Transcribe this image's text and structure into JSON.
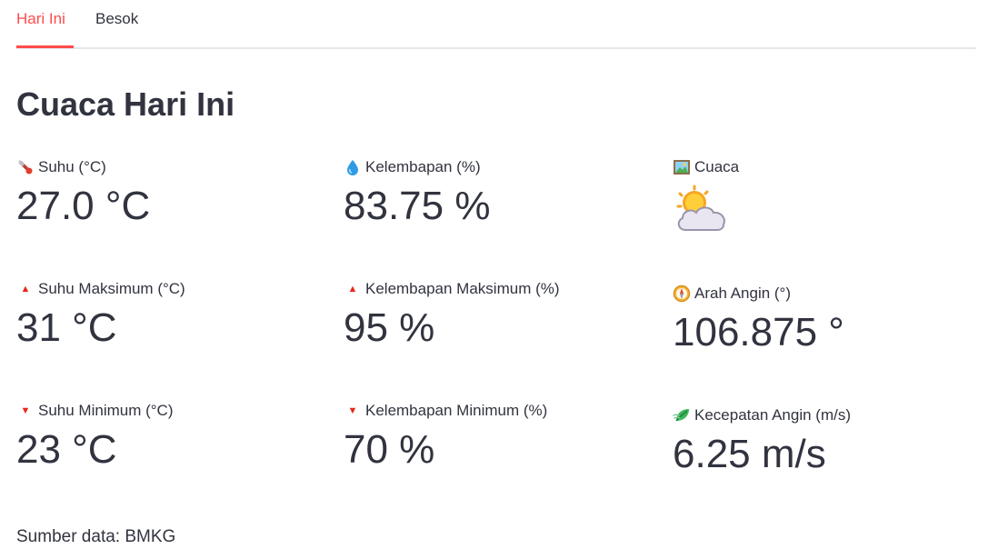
{
  "tabs": [
    {
      "label": "Hari Ini",
      "active": true
    },
    {
      "label": "Besok",
      "active": false
    }
  ],
  "title": "Cuaca Hari Ini",
  "metrics": {
    "suhu": {
      "label": "Suhu (°C)",
      "value": "27.0 °C",
      "icon": "thermometer-icon"
    },
    "kelembapan": {
      "label": "Kelembapan (%)",
      "value": "83.75 %",
      "icon": "droplet-icon"
    },
    "cuaca": {
      "label": "Cuaca",
      "icon": "picture-icon",
      "value_icon": "sun-behind-cloud-icon"
    },
    "suhu_max": {
      "label": "Suhu Maksimum (°C)",
      "value": "31 °C",
      "icon": "arrow-up-icon"
    },
    "kelembapan_max": {
      "label": "Kelembapan Maksimum (%)",
      "value": "95 %",
      "icon": "arrow-up-icon"
    },
    "arah_angin": {
      "label": "Arah Angin (°)",
      "value": "106.875 °",
      "icon": "compass-icon"
    },
    "suhu_min": {
      "label": "Suhu Minimum (°C)",
      "value": "23 °C",
      "icon": "arrow-down-icon"
    },
    "kelembapan_min": {
      "label": "Kelembapan Minimum (%)",
      "value": "70 %",
      "icon": "arrow-down-icon"
    },
    "kecepatan_angin": {
      "label": "Kecepatan Angin (m/s)",
      "value": "6.25 m/s",
      "icon": "leaf-wind-icon"
    }
  },
  "footer": "Sumber data: BMKG",
  "colors": {
    "accent": "#ff4b4b",
    "text": "#31333f",
    "arrow": "#e8271b"
  }
}
